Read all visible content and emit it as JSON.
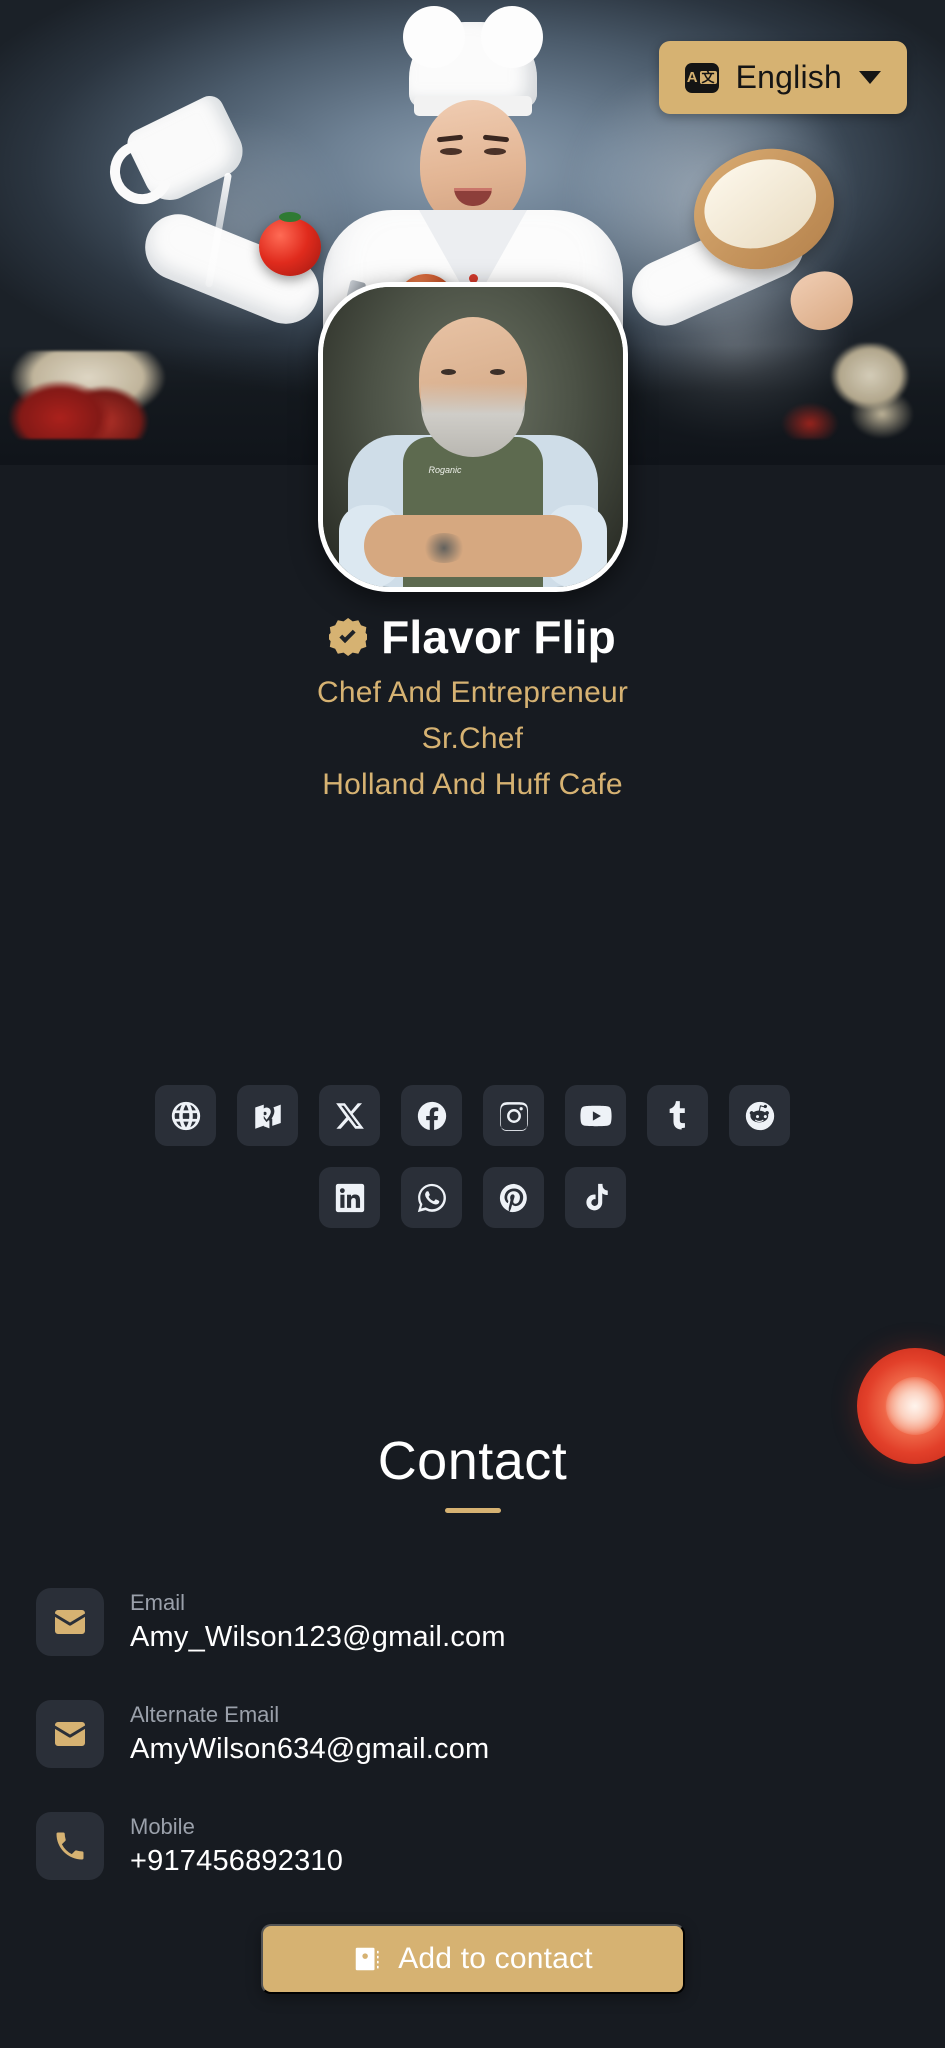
{
  "language_selector": {
    "label": "English",
    "icon": "translate-icon",
    "caret": "chevron-down-icon",
    "bg_color": "#d6b272"
  },
  "hero": {
    "banner_icon": "chef-banner-image",
    "avatar_icon": "profile-avatar-image",
    "apron_text": "Roganic"
  },
  "profile": {
    "verified_badge": "verified-badge-icon",
    "name": "Flavor Flip",
    "tagline": "Chef And Entrepreneur",
    "role": "Sr.Chef",
    "company": "Holland And Huff Cafe",
    "accent_color": "#d6b272"
  },
  "socials": {
    "row1": [
      {
        "name": "website",
        "icon": "globe-icon"
      },
      {
        "name": "location",
        "icon": "map-pin-icon"
      },
      {
        "name": "x-twitter",
        "icon": "x-icon"
      },
      {
        "name": "facebook",
        "icon": "facebook-icon"
      },
      {
        "name": "instagram",
        "icon": "instagram-icon"
      },
      {
        "name": "youtube",
        "icon": "youtube-icon"
      },
      {
        "name": "tumblr",
        "icon": "tumblr-icon"
      },
      {
        "name": "reddit",
        "icon": "reddit-icon"
      }
    ],
    "row2": [
      {
        "name": "linkedin",
        "icon": "linkedin-icon"
      },
      {
        "name": "whatsapp",
        "icon": "whatsapp-icon"
      },
      {
        "name": "pinterest",
        "icon": "pinterest-icon"
      },
      {
        "name": "tiktok",
        "icon": "tiktok-icon"
      }
    ]
  },
  "contact": {
    "title": "Contact",
    "rows": [
      {
        "icon": "envelope-icon",
        "label": "Email",
        "value": "Amy_Wilson123@gmail.com"
      },
      {
        "icon": "envelope-icon",
        "label": "Alternate Email",
        "value": "AmyWilson634@gmail.com"
      },
      {
        "icon": "phone-icon",
        "label": "Mobile",
        "value": "+917456892310"
      }
    ]
  },
  "cta": {
    "label": "Add to contact",
    "icon": "contact-card-icon",
    "bg_color": "#d6b272"
  },
  "decor": {
    "tomato": "tomato-slice-decor"
  }
}
